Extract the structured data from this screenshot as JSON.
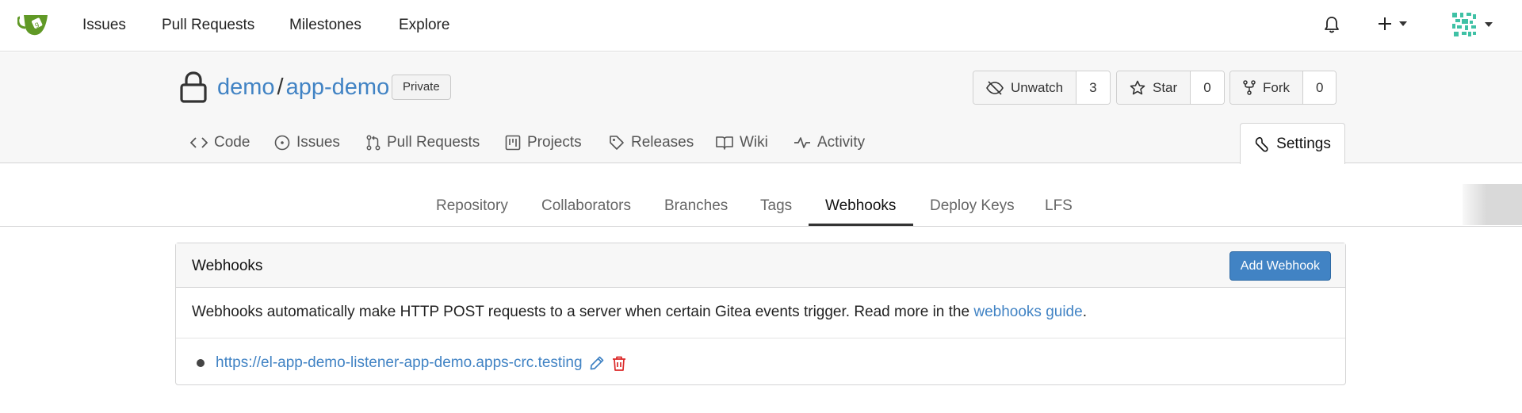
{
  "navbar": {
    "logo": "gitea-logo",
    "items": [
      "Issues",
      "Pull Requests",
      "Milestones",
      "Explore"
    ],
    "icons": [
      "bell-icon",
      "plus-icon",
      "avatar"
    ]
  },
  "repo": {
    "owner": "demo",
    "separator": "/",
    "name": "app-demo",
    "visibility": "Private",
    "unwatch_label": "Unwatch",
    "watch_count": "3",
    "star_label": "Star",
    "star_count": "0",
    "fork_label": "Fork",
    "fork_count": "0"
  },
  "repo_tabs": [
    "Code",
    "Issues",
    "Pull Requests",
    "Projects",
    "Releases",
    "Wiki",
    "Activity"
  ],
  "settings_tab": "Settings",
  "settings_menu": {
    "items": [
      "Repository",
      "Collaborators",
      "Branches",
      "Tags",
      "Webhooks",
      "Deploy Keys",
      "LFS"
    ],
    "active": "Webhooks"
  },
  "webhooks": {
    "title": "Webhooks",
    "add_button": "Add Webhook",
    "description_prefix": "Webhooks automatically make HTTP POST requests to a server when certain Gitea events trigger. Read more in the",
    "description_link": "webhooks guide",
    "description_suffix": ".",
    "hooks": [
      {
        "url": "https://el-app-demo-listener-app-demo.apps-crc.testing"
      }
    ]
  },
  "colors": {
    "link": "#4183c4",
    "primary_button": "#4183c4",
    "delete": "#db2828",
    "header_bg": "#f7f7f7"
  }
}
